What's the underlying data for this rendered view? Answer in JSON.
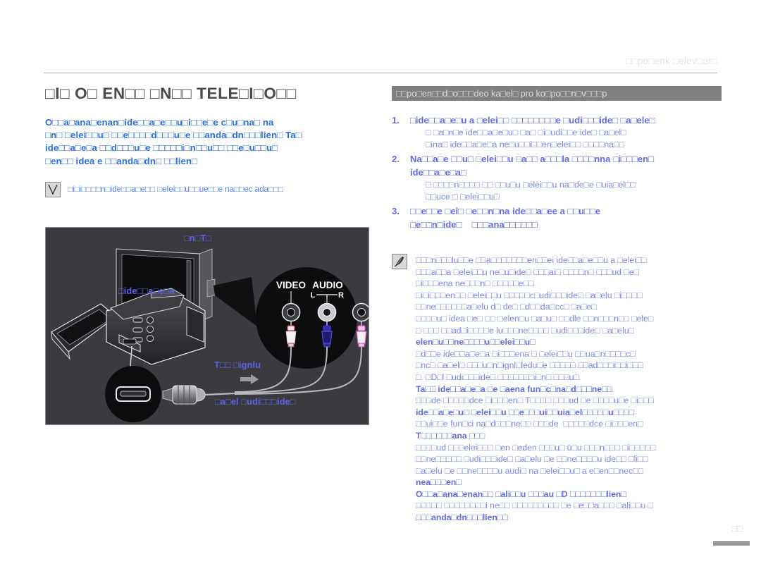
{
  "header": {
    "running_title": "□□po□enk □elev□or□"
  },
  "title": "□I□ O□ EN□□ □N□□ TELE□I□O□□",
  "left": {
    "intro": "O□□a□ana□enan□ide□□a□e□□u□i□□e□e c□u□na□ na\n□n□ □elei□□u□ □□e□□□□d□□□u□e □□anda□dn□□□lien□ Ta□\nide□□a□e□a □□d□□□u□e □□□□□i□n□□u□□ □□e□u□□u□\n□en□□ idea e □□anda□dn□ □□lien□",
    "note": {
      "icon": "check-icon",
      "text": "□i□i□□□□n□ide□□a□e□□ □elei□□u□□ue□□e na□□ec ada□□□"
    }
  },
  "illustration": {
    "labels": {
      "tv": "□n□T□",
      "camera": "□ide□□a□e□a",
      "signal": "T□□ □ignlu",
      "cable": "□a□el □udi□□□ide□"
    },
    "jack_panel": {
      "video": "VIDEO",
      "audio": "AUDIO",
      "left": "L",
      "right": "R"
    },
    "background_color": "#3b3b3f",
    "accent_color": "#5b63e8"
  },
  "right": {
    "band": "□□po□en□□d□o□□□deo ka□el□ pro ko□po□□n□v□□□p",
    "steps": [
      {
        "num": "1.",
        "main": "□ide□□a□e□u a □elei□□ □□□□□□□□e □udi□□□ide□ □a□ele□",
        "subs": [
          "□ □a□n□e ide□□a□e□u□ □a□ □i□udi□□e ide□ □a□el□",
          "□ina□ ide□□a□e□a ne□u□□i□□en□elei□□ □□□□na□□"
        ]
      },
      {
        "num": "2.",
        "main": "Na□□a□e □□u□ □elei□□u □a□□ a□□□la □□□□nna □i□□□en□\nide□□a□e□a□",
        "subs": [
          "□ □□□□n□□□□ □□ □□u□u □elei□□u na□de□e □uia□el□□",
          "□□uce □ □elei□□u□"
        ]
      },
      {
        "num": "3.",
        "main": "□□e□□e □ei□ □e□□n□na ide□□a□ee a □□u□□e\n□e□□n□ide□    □□□ana□□□□□□"
      }
    ],
    "notes": {
      "icon": "pencil-icon",
      "lines": [
        {
          "bold": false,
          "text": "□□□n□□□lu□□e □□a□□□□□□□en□□ei ide□□a□e□□u a □elei□□"
        },
        {
          "bold": false,
          "text": "□□□a□□a □elei□□u ne□u□ide□ □□□ai□ □□□□n□ □□□ud □e□"
        },
        {
          "bold": false,
          "text": "□i□□□ena ne□□□n□ □□□□□e□□"
        },
        {
          "bold": false,
          "text": "□i□i□□□en□□ □elei□□u □□□□□c□udi□□□ide□ □a□elu □i□□□□"
        },
        {
          "bold": false,
          "text": "□□ne□□□□□□a□elu d□ de□ □d□□da□cc□ □a□e□"
        },
        {
          "bold": false,
          "text": "□□□□u□ idea □e□ □□ □elen□u □a□u□ □□dle □□n□□□n□□ □ele□"
        },
        {
          "bold": false,
          "text": "□ □□□ □□ad□i□□□□e lu□□□ne□□□□ □udi□□□ide□ □a□elu□"
        },
        {
          "bold": true,
          "text": "elen□u□□ne□□□□u□□elei□□u□"
        },
        {
          "bold": false,
          "text": "□d□□e ide□□a□e□a □i□□□ena □ □elei□□u □□ua□n□□□□c□"
        },
        {
          "bold": false,
          "text": "□nc□ □a□el□ □□□u□n□ignl□ledu□e □□□□□ □□ad□□□i□□i□□□"
        },
        {
          "bold": false,
          "text": "□  □D□l □udi□□□ide□ □□□□□□□i□n□ □□□u□"
        },
        {
          "bold": true,
          "text": "Ta□□ ide□□a□e□a □e □aena fun□c□na□d□□□ne□□"
        },
        {
          "bold": false,
          "text": "□□□de □□□□□dce □i□□□en□ T□□□□ □□□ud □e □□□□u□e □i□□□"
        },
        {
          "bold": true,
          "text": "ide□□a□e□u□ □elei□□u □□e□□□ui□□uia□el□□□□□u□□□□"
        },
        {
          "bold": false,
          "text": "□□ui□□e fun□ci na□d□□□ne□□ □□□de  □□□□□dce □i□□□en□"
        },
        {
          "bold": true,
          "text": "T□□□□□□ana □□□"
        },
        {
          "bold": false,
          "text": "□□□□ud □□□elei□□□ □en □eden □□□u□ ū□u □□□n□□□ □i□□□□□"
        },
        {
          "bold": false,
          "text": "□□ne□□□□□ □udi□□□ide□ □a□elu □e □□ne□□□□u ide□□ □li□□"
        },
        {
          "bold": false,
          "text": "□a□elu □e □□ne□□□□u audi□ na □elei□□u□ a e□en□□nec□□"
        },
        {
          "bold": true,
          "text": "nea□□□en□"
        },
        {
          "bold": true,
          "text": "O□□a□ana□enan□□ □ali□□u □□□au □D □□□□□□□lien□"
        },
        {
          "bold": false,
          "text": "□□□□□ □□□□□□□□i ne□□ □□□□□□□□□ □e □e□□a□□□ □ali□□u □"
        },
        {
          "bold": true,
          "text": "□□□anda□dn□□□lien□□"
        }
      ]
    }
  },
  "page_number": "□□"
}
